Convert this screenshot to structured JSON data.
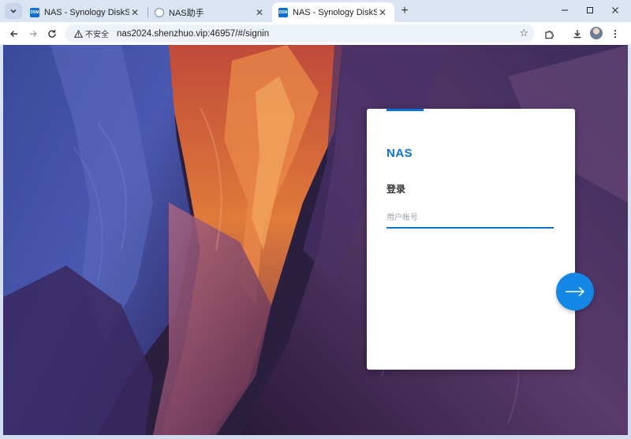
{
  "tabs": [
    {
      "label": "NAS - Synology DiskStation",
      "favicon": "DSM",
      "active": false
    },
    {
      "label": "NAS助手",
      "favicon": "helper",
      "active": false
    },
    {
      "label": "NAS - Synology DiskStation",
      "favicon": "DSM",
      "active": true
    }
  ],
  "toolbar": {
    "security_label": "不安全",
    "url": "nas2024.shenzhuo.vip:46957/#/signin"
  },
  "login": {
    "brand": "NAS",
    "title": "登录",
    "username_placeholder": "用户帐号",
    "username_value": ""
  },
  "colors": {
    "accent": "#0b74d4",
    "button": "#1486e6"
  },
  "icons": {
    "tab_menu": "chevron-down-icon",
    "new_tab": "plus-icon",
    "back": "back-arrow-icon",
    "forward": "forward-arrow-icon",
    "reload": "reload-icon",
    "warning": "warning-triangle-icon",
    "bookmark": "star-icon",
    "extensions": "puzzle-icon",
    "download": "download-icon",
    "menu": "kebab-menu-icon",
    "next": "arrow-right-icon"
  }
}
